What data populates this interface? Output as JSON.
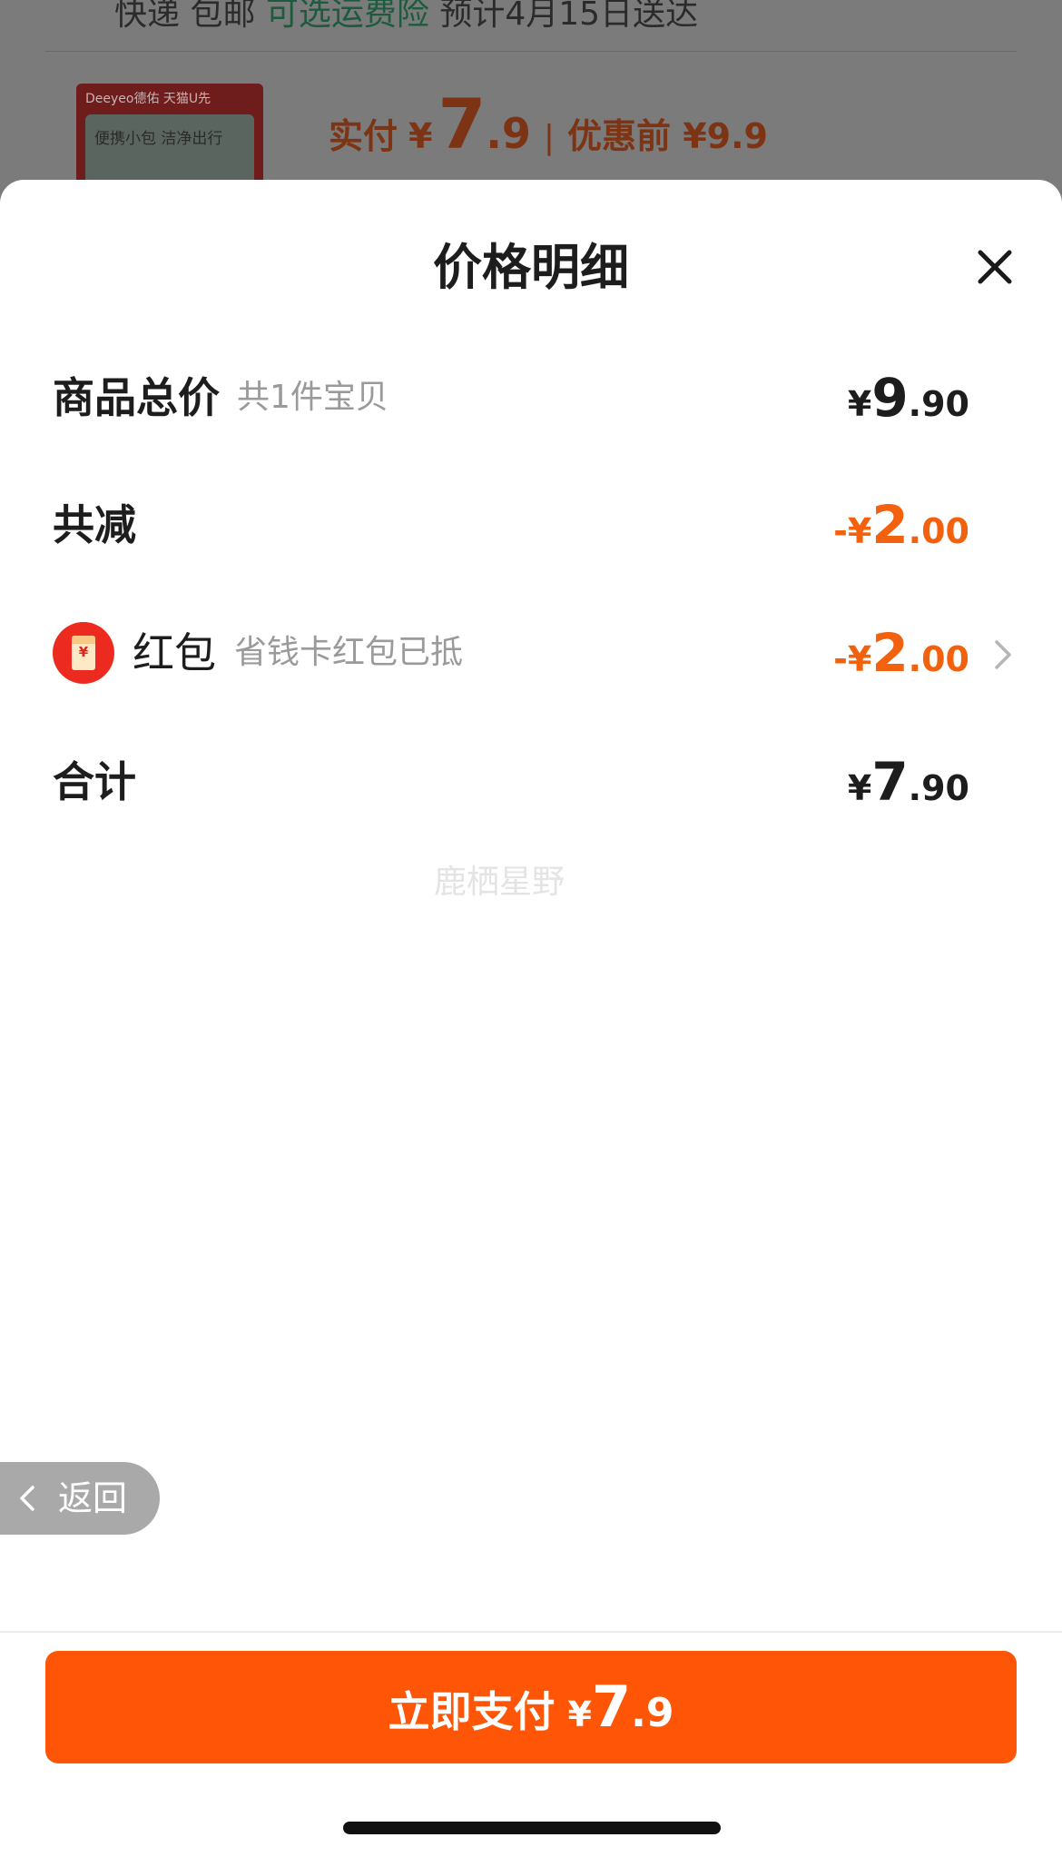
{
  "background_order": {
    "shipping_method": "快递 包邮",
    "insurance_link": "可选运费险",
    "delivery_estimate": "预计4月15日送达",
    "thumb_brand": "Deeyeo德佑  天猫U先",
    "thumb_text": "便携小包 洁净出行",
    "paid_label": "实付",
    "paid_currency": "¥",
    "paid_integer": "7",
    "paid_decimal": ".9",
    "separator": "|",
    "original_price": "优惠前 ¥9.9"
  },
  "sheet": {
    "title": "价格明细",
    "rows": {
      "subtotal": {
        "label": "商品总价",
        "sub": "共1件宝贝",
        "currency": "¥",
        "integer": "9",
        "decimal": ".90"
      },
      "discount": {
        "label": "共减",
        "currency": "-¥",
        "integer": "2",
        "decimal": ".00"
      },
      "redpacket": {
        "label": "红包",
        "sub": "省钱卡红包已抵",
        "icon_yen": "¥",
        "currency": "-¥",
        "integer": "2",
        "decimal": ".00"
      },
      "total": {
        "label": "合计",
        "currency": "¥",
        "integer": "7",
        "decimal": ".90"
      }
    },
    "watermark": "鹿栖星野"
  },
  "back_button": {
    "label": "返回"
  },
  "pay_button": {
    "label": "立即支付",
    "currency": "¥",
    "integer": "7",
    "decimal": ".9"
  },
  "icons": {
    "close": "close-icon",
    "redpacket": "red-packet-icon",
    "chevron": "chevron-right-icon",
    "back": "chevron-left-icon"
  },
  "colors": {
    "accent": "#fe5507",
    "discount": "#f2620e",
    "text": "#1d1d1d",
    "muted": "#9a9a9a"
  }
}
